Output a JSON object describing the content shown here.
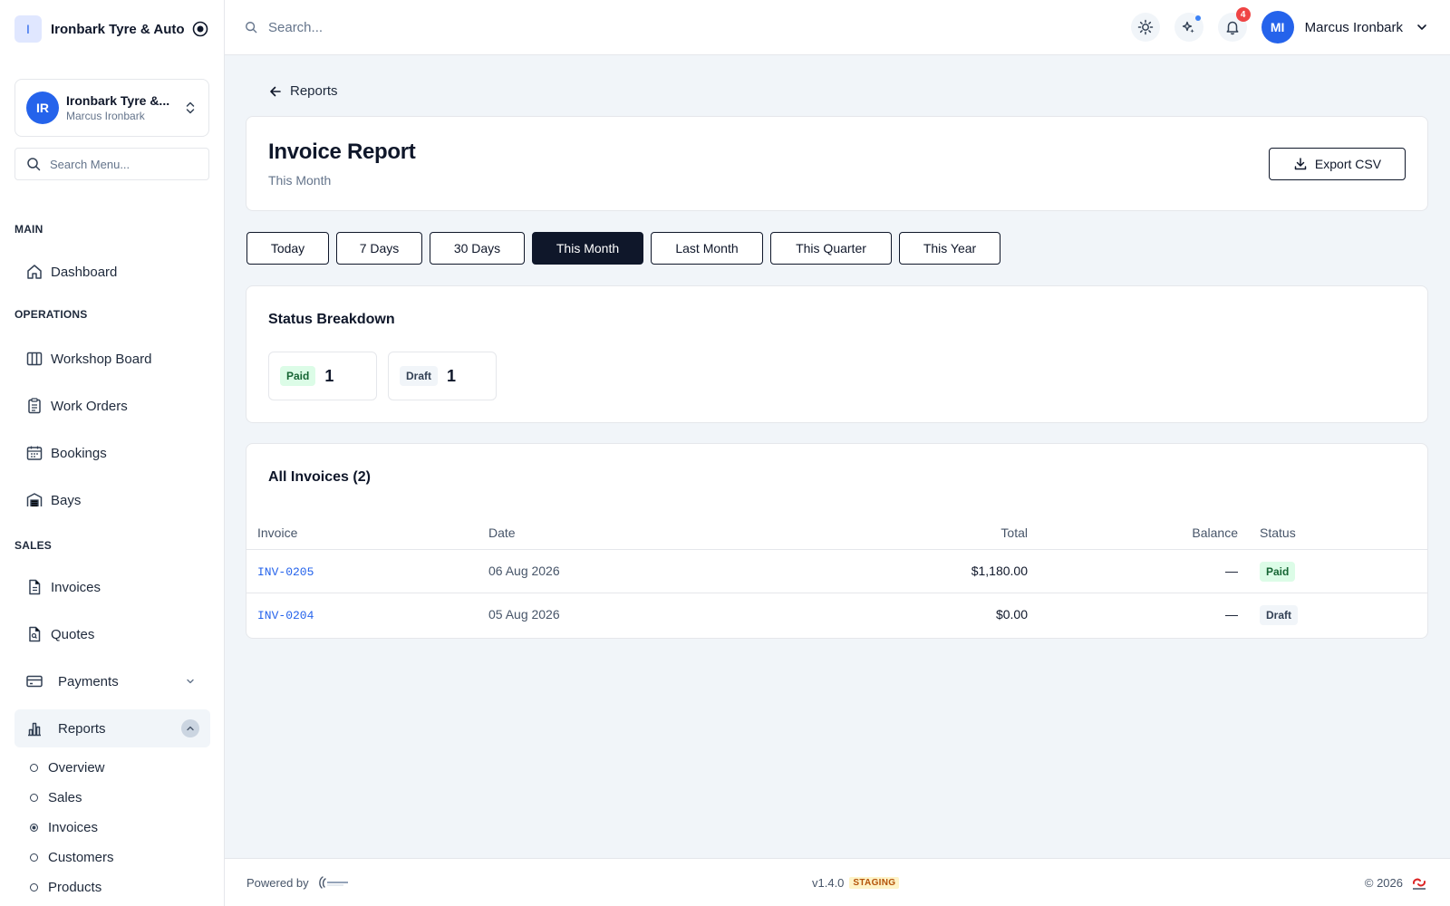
{
  "brand": {
    "initial": "I",
    "name": "Ironbark Tyre & Auto"
  },
  "org": {
    "initials": "IR",
    "name": "Ironbark Tyre &...",
    "user": "Marcus Ironbark"
  },
  "sidebar": {
    "search_placeholder": "Search Menu...",
    "sections": {
      "main": "MAIN",
      "operations": "OPERATIONS",
      "sales": "SALES"
    },
    "items": {
      "dashboard": "Dashboard",
      "workshop_board": "Workshop Board",
      "work_orders": "Work Orders",
      "bookings": "Bookings",
      "bays": "Bays",
      "invoices": "Invoices",
      "quotes": "Quotes",
      "payments": "Payments",
      "reports": "Reports"
    },
    "report_subitems": [
      "Overview",
      "Sales",
      "Invoices",
      "Customers",
      "Products"
    ],
    "active_subitem": "Invoices"
  },
  "topbar": {
    "search_placeholder": "Search...",
    "notification_count": "4",
    "user_initials": "MI",
    "user_name": "Marcus Ironbark"
  },
  "page": {
    "back_label": "Reports",
    "title": "Invoice Report",
    "subtitle": "This Month",
    "export_label": "Export CSV"
  },
  "range_tabs": [
    "Today",
    "7 Days",
    "30 Days",
    "This Month",
    "Last Month",
    "This Quarter",
    "This Year"
  ],
  "active_range": "This Month",
  "status_breakdown": {
    "title": "Status Breakdown",
    "items": [
      {
        "label": "Paid",
        "count": "1"
      },
      {
        "label": "Draft",
        "count": "1"
      }
    ]
  },
  "invoices": {
    "title": "All Invoices (2)",
    "columns": [
      "Invoice",
      "Date",
      "Total",
      "Balance",
      "Status"
    ],
    "rows": [
      {
        "invoice": "INV-0205",
        "date": "06 Aug 2026",
        "total": "$1,180.00",
        "balance": "—",
        "status": "Paid"
      },
      {
        "invoice": "INV-0204",
        "date": "05 Aug 2026",
        "total": "$0.00",
        "balance": "—",
        "status": "Draft"
      }
    ]
  },
  "footer": {
    "powered_by": "Powered by",
    "version": "v1.4.0",
    "env": "STAGING",
    "copyright": "© 2026"
  },
  "colors": {
    "accent": "#2563eb",
    "dark": "#0f172a",
    "paid_bg": "#dcfce7",
    "paid_fg": "#166534",
    "danger": "#ef4444",
    "staging_bg": "#fef3c7"
  }
}
